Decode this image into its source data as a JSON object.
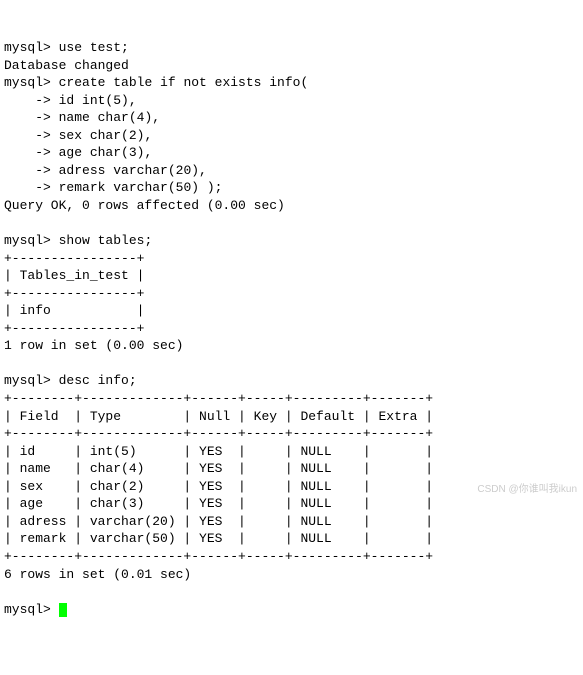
{
  "prompt": "mysql>",
  "cont_prompt": "    ->",
  "commands": {
    "use_db": "use test;",
    "db_changed": "Database changed",
    "create_table": "create table if not exists info(",
    "create_lines": [
      "id int(5),",
      "name char(4),",
      "sex char(2),",
      "age char(3),",
      "adress varchar(20),",
      "remark varchar(50) );"
    ],
    "query_ok": "Query OK, 0 rows affected (0.00 sec)",
    "show_tables": "show tables;",
    "desc": "desc info;"
  },
  "tables_block": {
    "border": "+----------------+",
    "header": "| Tables_in_test |",
    "row": "| info           |",
    "footer": "1 row in set (0.00 sec)"
  },
  "desc_block": {
    "border": "+--------+-------------+------+-----+---------+-------+",
    "header": "| Field  | Type        | Null | Key | Default | Extra |",
    "rows": [
      "| id     | int(5)      | YES  |     | NULL    |       |",
      "| name   | char(4)     | YES  |     | NULL    |       |",
      "| sex    | char(2)     | YES  |     | NULL    |       |",
      "| age    | char(3)     | YES  |     | NULL    |       |",
      "| adress | varchar(20) | YES  |     | NULL    |       |",
      "| remark | varchar(50) | YES  |     | NULL    |       |"
    ],
    "footer": "6 rows in set (0.01 sec)"
  },
  "watermark": "CSDN @你谁叫我ikun"
}
